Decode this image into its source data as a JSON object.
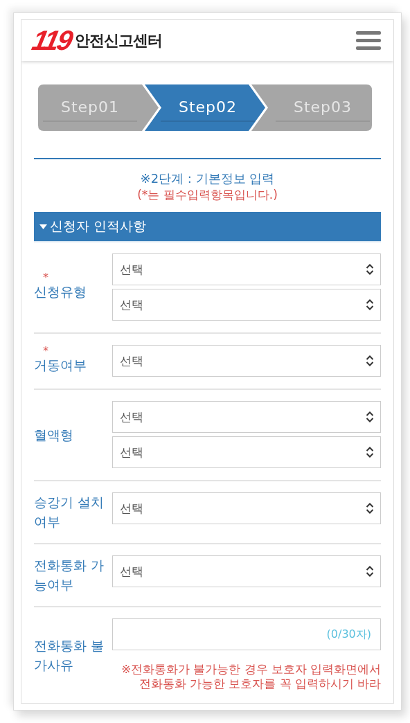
{
  "header": {
    "logo_number": "119",
    "logo_text": "안전신고센터"
  },
  "steps": [
    {
      "label": "Step01",
      "selected": false
    },
    {
      "label": "Step02",
      "selected": true
    },
    {
      "label": "Step03",
      "selected": false
    }
  ],
  "intro": {
    "title": "※2단계 : 기본정보 입력",
    "note": "(*는 필수입력항목입니다.)"
  },
  "section": {
    "title": "신청자 인적사항",
    "expanded": true
  },
  "fields": [
    {
      "label": "신청유형",
      "required_mark": "*",
      "kind": "select",
      "controls": [
        {
          "value": "선택"
        },
        {
          "value": "선택"
        }
      ]
    },
    {
      "label": "거동여부",
      "required_mark": "*",
      "kind": "select",
      "controls": [
        {
          "value": "선택"
        }
      ]
    },
    {
      "label": "혈액형",
      "kind": "select",
      "controls": [
        {
          "value": "선택"
        },
        {
          "value": "선택"
        }
      ]
    },
    {
      "label": "승강기 설치여부",
      "kind": "select",
      "controls": [
        {
          "value": "선택"
        }
      ]
    },
    {
      "label": "전화통화 가능여부",
      "kind": "select",
      "controls": [
        {
          "value": "선택"
        }
      ]
    },
    {
      "label": "전화통화 불가사유",
      "kind": "text",
      "counter": "(0/30자)",
      "note": "※전화통화가 불가능한 경우 보호자 입력화면에서 전화통화 가능한 보호자를 꼭 입력하시기 바라"
    }
  ]
}
